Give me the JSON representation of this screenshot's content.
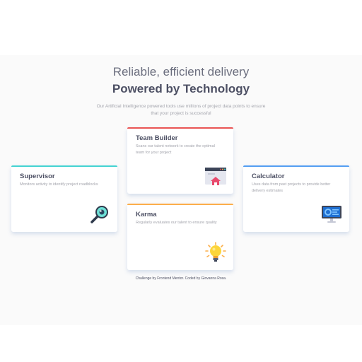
{
  "header": {
    "line1": "Reliable, efficient delivery",
    "line2": "Powered by Technology",
    "intro": "Our Artificial Intelligence powered tools use millions of project data points to ensure that your project is successful"
  },
  "cards": {
    "supervisor": {
      "title": "Supervisor",
      "description": "Monitors activity to identify project roadblocks",
      "accent": "#44d3d2",
      "icon": "magnifier-icon"
    },
    "team_builder": {
      "title": "Team Builder",
      "description": "Scans our talent network to create the optimal team for your project",
      "accent": "#ea5454",
      "icon": "team-builder-icon"
    },
    "karma": {
      "title": "Karma",
      "description": "Regularly evaluates our talent to ensure quality",
      "accent": "#fcae4a",
      "icon": "lightbulb-icon"
    },
    "calculator": {
      "title": "Calculator",
      "description": "Uses data from past projects to provide better delivery estimates",
      "accent": "#549ef2",
      "icon": "monitor-icon"
    }
  },
  "footer": {
    "attribution": "Challenge by Frontend Mentor. Coded by Giovanna Rosa."
  }
}
